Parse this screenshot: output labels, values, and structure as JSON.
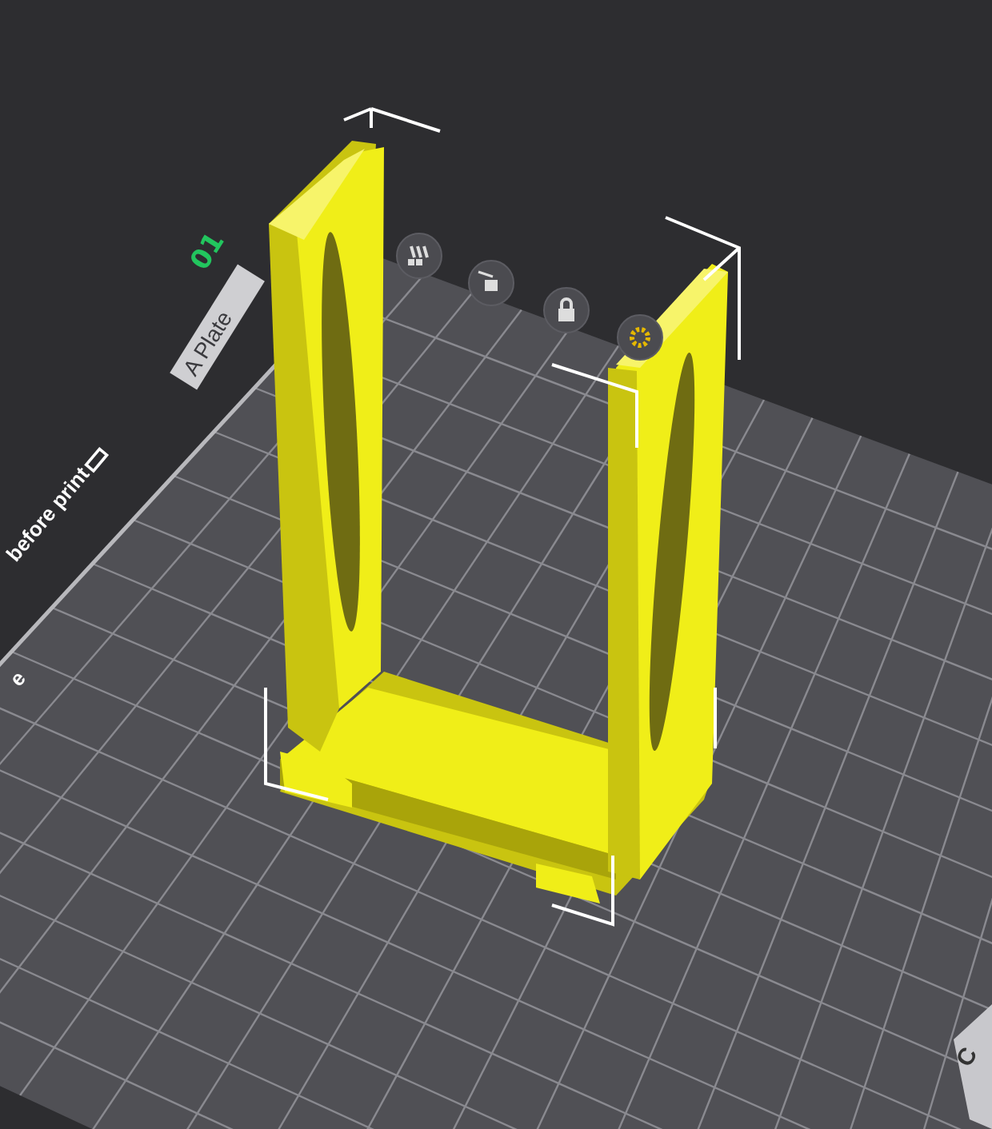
{
  "plate": {
    "number": "01",
    "name": "A Plate"
  },
  "side_labels": [
    {
      "text": "before print"
    },
    {
      "text": "e"
    }
  ],
  "corner_label": "C"
}
